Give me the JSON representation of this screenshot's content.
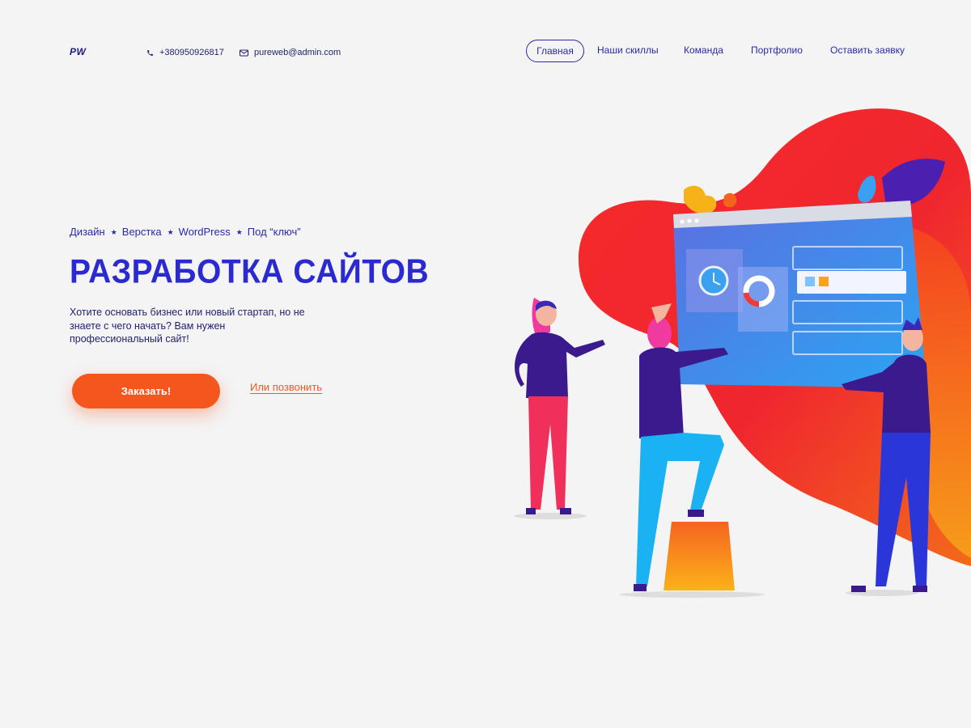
{
  "header": {
    "logo": "PW",
    "phone": "+380950926817",
    "email": "pureweb@admin.com",
    "nav": [
      "Главная",
      "Наши скиллы",
      "Команда",
      "Портфолио",
      "Оставить заявку"
    ],
    "active_nav": "Главная"
  },
  "hero": {
    "services": [
      "Дизайн",
      "Верстка",
      "WordPress",
      "Под “ключ”"
    ],
    "title": "РАЗРАБОТКА САЙТОВ",
    "text": "Хотите основать бизнес или новый стартап, но не знаете с чего начать? Вам нужен профессиональный сайт!",
    "cta_label": "Заказать!",
    "call_link": "Или позвонить"
  },
  "colors": {
    "primary": "#2a2ad0",
    "accent": "#f5561e",
    "background": "#f4f4f5"
  },
  "icons": {
    "phone": "phone-icon",
    "email": "envelope-icon",
    "separator": "star-icon"
  }
}
